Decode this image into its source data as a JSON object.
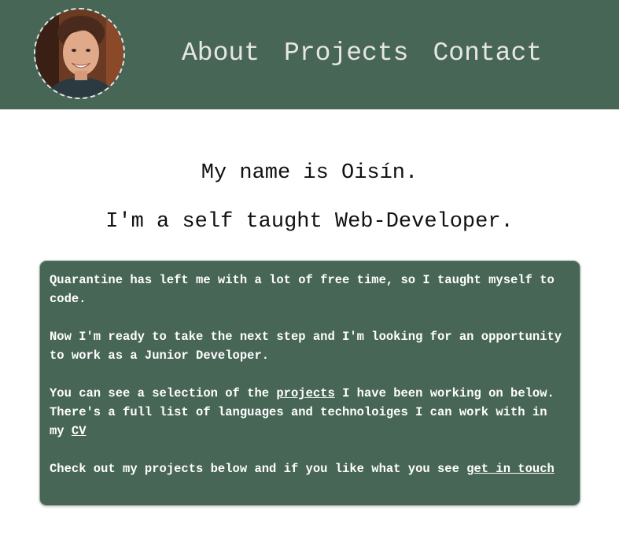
{
  "header": {
    "avatar_alt": "Profile photo",
    "nav": [
      {
        "label": "About"
      },
      {
        "label": "Projects"
      },
      {
        "label": "Contact"
      }
    ]
  },
  "intro": {
    "line1": "My name is Oisín.",
    "line2": "I'm a self taught Web-Developer."
  },
  "card": {
    "p1": "Quarantine has left me with a lot of free time, so I taught myself to code.",
    "p2_before": "Now I'm ready to take the next step and I'm looking for an opportunity to work as a ",
    "p2_bold": "Junior Developer.",
    "p3_before": "You can see a selection of the ",
    "p3_link": "projects",
    "p3_middle": " I have been working on below. There's a full list of languages and technoloiges I can work with in my ",
    "p3_link2": "CV",
    "p4_before": "Check out my projects below and if you like what you see ",
    "p4_link": "get in touch"
  },
  "colors": {
    "brand_green": "#476655",
    "nav_text": "#e6e6e6",
    "body_text": "#111111"
  }
}
